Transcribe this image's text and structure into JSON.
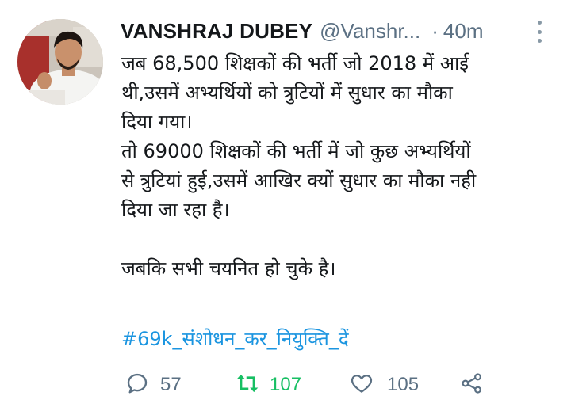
{
  "tweet": {
    "author_name": "VANSHRAJ DUBEY",
    "handle": "@Vanshr...",
    "separator": "·",
    "time": "40m",
    "text_lines": [
      "जब 68,500 शिक्षकों की भर्ती जो 2018 में आई",
      "थी,उसमें अभ्यर्थियों को त्रुटियों में सुधार का मौका",
      "दिया गया।",
      "तो 69000 शिक्षकों की भर्ती में जो कुछ अभ्यर्थियों",
      "से त्रुटियां हुई,उसमें आखिर क्यों सुधार का मौका नही",
      "दिया जा रहा है।",
      "",
      "जबकि सभी चयनित हो चुके है।"
    ],
    "hashtag": "#69k_संशोधन_कर_नियुक्ति_दें"
  },
  "actions": {
    "reply": {
      "icon": "reply-icon",
      "count": "57"
    },
    "retweet": {
      "icon": "retweet-icon",
      "count": "107"
    },
    "like": {
      "icon": "heart-icon",
      "count": "105"
    },
    "share": {
      "icon": "share-icon"
    }
  },
  "colors": {
    "text": "#14171a",
    "secondary": "#5b7083",
    "link": "#1b95e0",
    "retweet_active": "#17bf63",
    "icon_gray": "#5b7083"
  }
}
